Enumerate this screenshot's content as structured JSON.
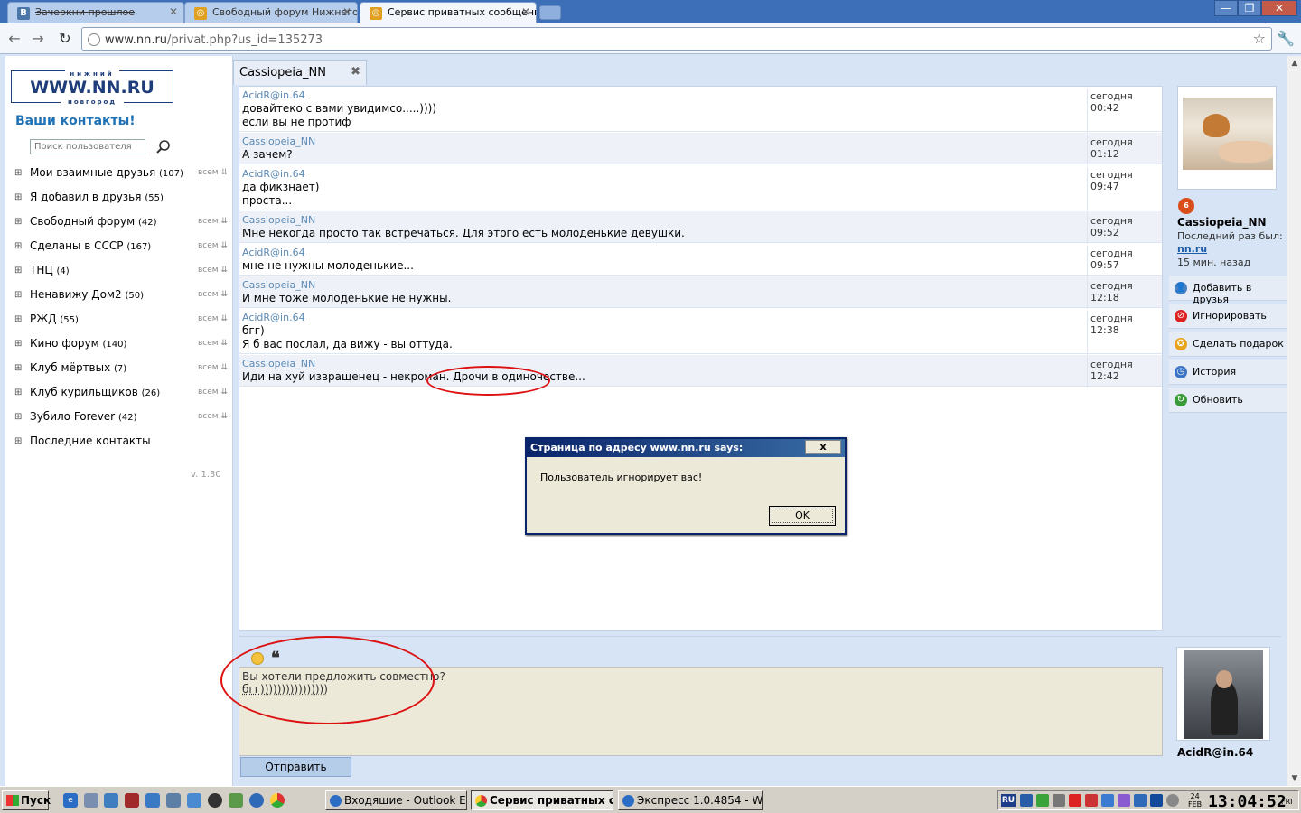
{
  "browser": {
    "tabs": [
      {
        "title": "Зачеркни прошлое",
        "favicon": "В"
      },
      {
        "title": "Свободный форум Нижнего Н",
        "favicon": "◎"
      },
      {
        "title": "Сервис приватных сообщени",
        "favicon": "◎"
      }
    ],
    "url_host": "www.nn.ru",
    "url_path": "/privat.php?us_id=135273",
    "window_controls": [
      "minimize-icon",
      "restore-icon",
      "close-icon"
    ]
  },
  "logo": {
    "top": "нижний",
    "main": "WWW.NN.RU",
    "bottom": "новгород"
  },
  "sidebar": {
    "title": "Ваши контакты!",
    "search_placeholder": "Поиск пользователя",
    "all_label": "всем",
    "groups": [
      {
        "name": "Мои взаимные друзья",
        "count": "(107)",
        "has_all": true
      },
      {
        "name": "Я добавил в друзья",
        "count": "(55)",
        "has_all": false
      },
      {
        "name": "Свободный форум",
        "count": "(42)",
        "has_all": true
      },
      {
        "name": "Сделаны в СССР",
        "count": "(167)",
        "has_all": true
      },
      {
        "name": "ТНЦ",
        "count": "(4)",
        "has_all": true
      },
      {
        "name": "Ненавижу Дом2",
        "count": "(50)",
        "has_all": true
      },
      {
        "name": "РЖД",
        "count": "(55)",
        "has_all": true
      },
      {
        "name": "Кино форум",
        "count": "(140)",
        "has_all": true
      },
      {
        "name": "Клуб мёртвых",
        "count": "(7)",
        "has_all": true
      },
      {
        "name": "Клуб курильщиков",
        "count": "(26)",
        "has_all": true
      },
      {
        "name": "Зубило Forever",
        "count": "(42)",
        "has_all": true
      },
      {
        "name": "Последние контакты",
        "count": "",
        "has_all": false
      }
    ],
    "version": "v. 1.30"
  },
  "chat": {
    "tab_label": "Cassiopeia_NN",
    "messages": [
      {
        "author": "AcidR@in.64",
        "lines": [
          "довайтеко с вами увидимсо.....))))",
          "если вы не протиф"
        ],
        "time": "сегодня 00:42"
      },
      {
        "author": "Cassiopeia_NN",
        "lines": [
          "А зачем?"
        ],
        "time": "сегодня 01:12"
      },
      {
        "author": "AcidR@in.64",
        "lines": [
          "да фикзнает)",
          "проста..."
        ],
        "time": "сегодня 09:47"
      },
      {
        "author": "Cassiopeia_NN",
        "lines": [
          "Мне некогда просто так встречаться. Для этого есть молоденькие девушки."
        ],
        "time": "сегодня 09:52"
      },
      {
        "author": "AcidR@in.64",
        "lines": [
          "мне не нужны молоденькие..."
        ],
        "time": "сегодня 09:57"
      },
      {
        "author": "Cassiopeia_NN",
        "lines": [
          "И мне тоже молоденькие не нужны."
        ],
        "time": "сегодня 12:18"
      },
      {
        "author": "AcidR@in.64",
        "lines": [
          "бгг)",
          "Я б вас послал, да вижу - вы оттуда."
        ],
        "time": "сегодня 12:38"
      },
      {
        "author": "Cassiopeia_NN",
        "lines": [
          "Иди на хуй извращенец - некроман. Дрочи в одиночестве..."
        ],
        "time": "сегодня 12:42"
      }
    ],
    "compose_lines": [
      "Вы хотели предложить совместно?",
      "бгг))))))))))))))))"
    ],
    "send_label": "Отправить"
  },
  "profile": {
    "name": "Cassiopeia_NN",
    "last_seen_label": "Последний раз был:",
    "last_site": "nn.ru",
    "last_ago": "15 мин. назад",
    "actions": [
      {
        "label": "Добавить в друзья",
        "icon": "add-friend-icon",
        "color": "#4a7fc1"
      },
      {
        "label": "Игнорировать",
        "icon": "block-icon",
        "color": "#d22"
      },
      {
        "label": "Сделать подарок",
        "icon": "gift-icon",
        "color": "#e8a41c"
      },
      {
        "label": "История",
        "icon": "clock-icon",
        "color": "#3b74c4"
      },
      {
        "label": "Обновить",
        "icon": "refresh-icon",
        "color": "#3a9a3a"
      }
    ],
    "my_name": "AcidR@in.64"
  },
  "dialog": {
    "title": "Страница по адресу www.nn.ru says:",
    "close": "x",
    "message": "Пользователь игнорирует вас!",
    "ok": "OK"
  },
  "taskbar": {
    "start": "Пуск",
    "tasks": [
      {
        "label": "Входящие - Outlook Exp...",
        "active": false
      },
      {
        "label": "Сервис приватных с...",
        "active": true
      },
      {
        "label": "Экспресс 1.0.4854 - Wi...",
        "active": false
      }
    ],
    "lang": "RU",
    "date_day": "24",
    "date_month": "FEB",
    "clock": "13:04:52",
    "weekday": "FRI"
  }
}
